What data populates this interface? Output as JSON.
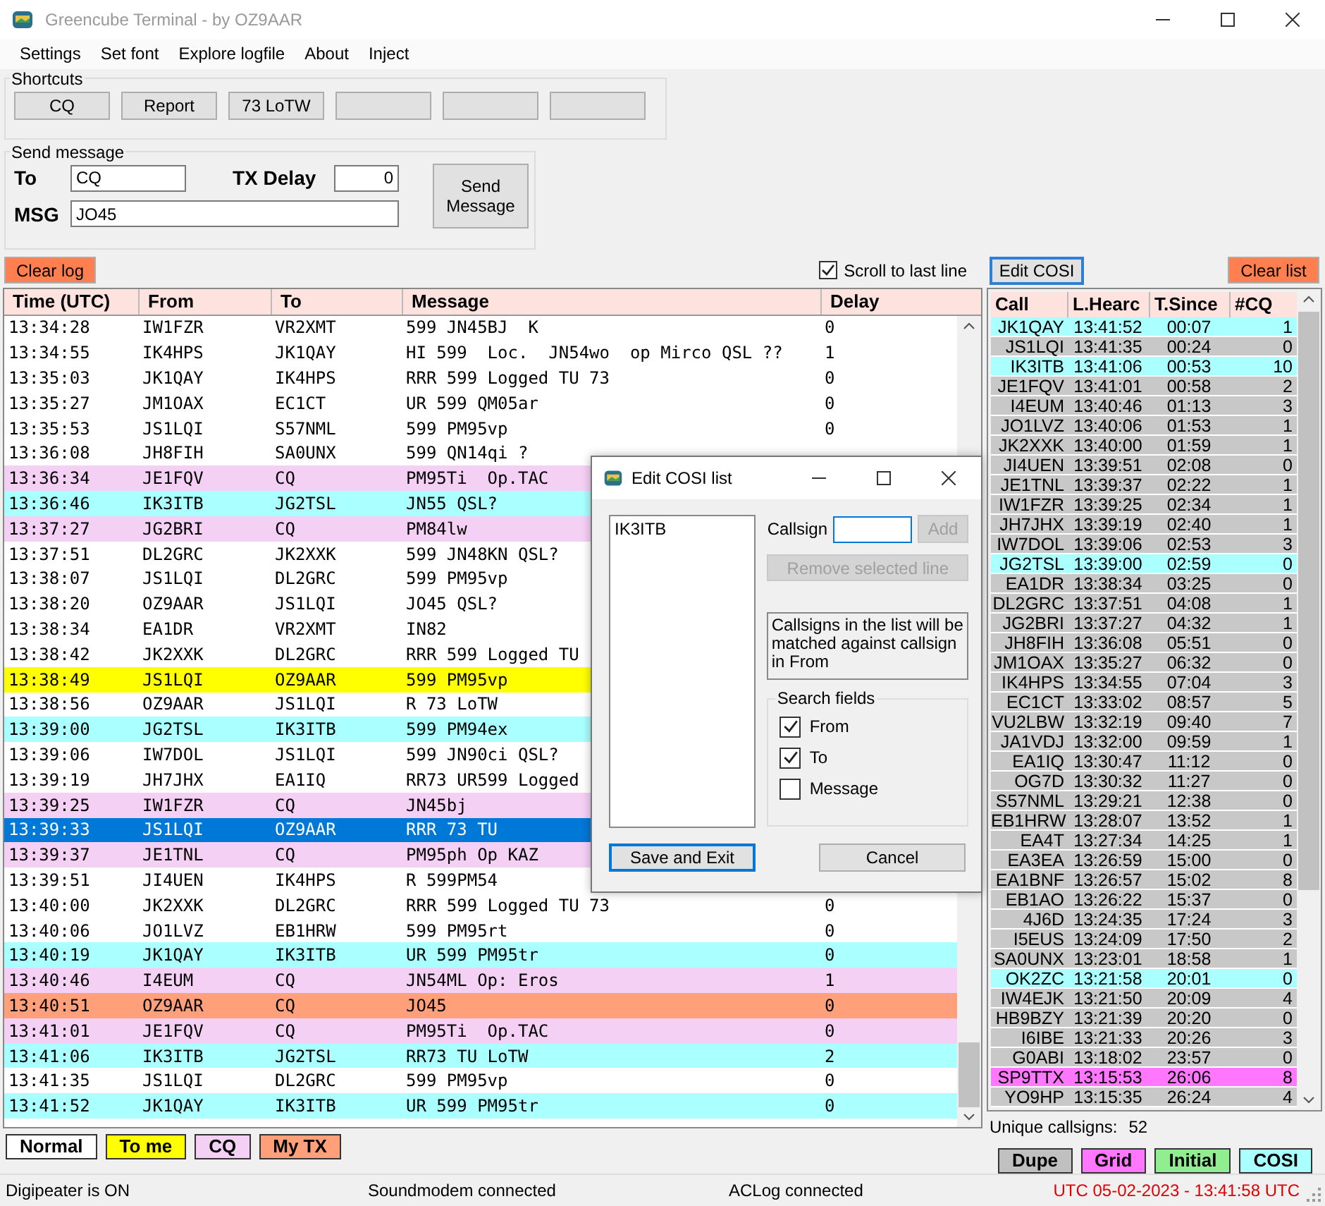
{
  "window": {
    "title": "Greencube Terminal - by OZ9AAR"
  },
  "menu": [
    "Settings",
    "Set font",
    "Explore logfile",
    "About",
    "Inject"
  ],
  "shortcuts": {
    "title": "Shortcuts",
    "buttons": [
      {
        "kind": "text",
        "label": "CQ"
      },
      {
        "kind": "text",
        "label": "Report"
      },
      {
        "kind": "text",
        "label": "73 LoTW"
      },
      {
        "kind": "blank"
      },
      {
        "kind": "blank"
      },
      {
        "kind": "blank"
      }
    ]
  },
  "send_message": {
    "title": "Send message",
    "to_label": "To",
    "to_value": "CQ",
    "tx_delay_label": "TX Delay",
    "tx_delay_value": "0",
    "msg_label": "MSG",
    "msg_value": "JO45",
    "send_button": "Send Message"
  },
  "clear_log": "Clear log",
  "scroll_to_last_line": {
    "label": "Scroll to last line",
    "checked": true
  },
  "log": {
    "columns": [
      "Time (UTC)",
      "From",
      "To",
      "Message",
      "Delay"
    ],
    "rows": [
      {
        "time": "13:34:28",
        "from": "IW1FZR",
        "to": "VR2XMT",
        "message": "599 JN45BJ  K",
        "delay": "0",
        "kind": "normal"
      },
      {
        "time": "13:34:55",
        "from": "IK4HPS",
        "to": "JK1QAY",
        "message": "HI 599  Loc.  JN54wo  op Mirco QSL ??",
        "delay": "1",
        "kind": "normal"
      },
      {
        "time": "13:35:03",
        "from": "JK1QAY",
        "to": "IK4HPS",
        "message": "RRR 599 Logged TU 73",
        "delay": "0",
        "kind": "normal"
      },
      {
        "time": "13:35:27",
        "from": "JM1OAX",
        "to": "EC1CT",
        "message": "UR 599 QM05ar",
        "delay": "0",
        "kind": "normal"
      },
      {
        "time": "13:35:53",
        "from": "JS1LQI",
        "to": "S57NML",
        "message": "599 PM95vp",
        "delay": "0",
        "kind": "normal"
      },
      {
        "time": "13:36:08",
        "from": "JH8FIH",
        "to": "SA0UNX",
        "message": "599 QN14qi ?",
        "kind": "normal"
      },
      {
        "time": "13:36:34",
        "from": "JE1FQV",
        "to": "CQ",
        "message": "PM95Ti  Op.TAC",
        "kind": "cq"
      },
      {
        "time": "13:36:46",
        "from": "IK3ITB",
        "to": "JG2TSL",
        "message": "JN55 QSL?",
        "kind": "cosi"
      },
      {
        "time": "13:37:27",
        "from": "JG2BRI",
        "to": "CQ",
        "message": "PM84lw",
        "kind": "cq"
      },
      {
        "time": "13:37:51",
        "from": "DL2GRC",
        "to": "JK2XXK",
        "message": "599 JN48KN QSL?",
        "kind": "normal"
      },
      {
        "time": "13:38:07",
        "from": "JS1LQI",
        "to": "DL2GRC",
        "message": "599 PM95vp",
        "kind": "normal"
      },
      {
        "time": "13:38:20",
        "from": "OZ9AAR",
        "to": "JS1LQI",
        "message": "JO45 QSL?",
        "kind": "normal"
      },
      {
        "time": "13:38:34",
        "from": "EA1DR",
        "to": "VR2XMT",
        "message": "IN82",
        "kind": "normal"
      },
      {
        "time": "13:38:42",
        "from": "JK2XXK",
        "to": "DL2GRC",
        "message": "RRR 599 Logged TU",
        "kind": "normal"
      },
      {
        "time": "13:38:49",
        "from": "JS1LQI",
        "to": "OZ9AAR",
        "message": "599 PM95vp",
        "kind": "to_me"
      },
      {
        "time": "13:38:56",
        "from": "OZ9AAR",
        "to": "JS1LQI",
        "message": "R 73 LoTW",
        "kind": "normal"
      },
      {
        "time": "13:39:00",
        "from": "JG2TSL",
        "to": "IK3ITB",
        "message": "599 PM94ex",
        "kind": "cosi"
      },
      {
        "time": "13:39:06",
        "from": "IW7DOL",
        "to": "JS1LQI",
        "message": "599 JN90ci QSL?",
        "kind": "normal"
      },
      {
        "time": "13:39:19",
        "from": "JH7JHX",
        "to": "EA1IQ",
        "message": "RR73 UR599 Logged",
        "kind": "normal"
      },
      {
        "time": "13:39:25",
        "from": "IW1FZR",
        "to": "CQ",
        "message": "JN45bj",
        "kind": "cq"
      },
      {
        "time": "13:39:33",
        "from": "JS1LQI",
        "to": "OZ9AAR",
        "message": "RRR 73 TU",
        "kind": "selected"
      },
      {
        "time": "13:39:37",
        "from": "JE1TNL",
        "to": "CQ",
        "message": "PM95ph Op KAZ",
        "kind": "cq"
      },
      {
        "time": "13:39:51",
        "from": "JI4UEN",
        "to": "IK4HPS",
        "message": "R 599PM54",
        "kind": "normal"
      },
      {
        "time": "13:40:00",
        "from": "JK2XXK",
        "to": "DL2GRC",
        "message": "RRR 599 Logged TU 73",
        "delay": "0",
        "kind": "normal"
      },
      {
        "time": "13:40:06",
        "from": "JO1LVZ",
        "to": "EB1HRW",
        "message": "599 PM95rt",
        "delay": "0",
        "kind": "normal"
      },
      {
        "time": "13:40:19",
        "from": "JK1QAY",
        "to": "IK3ITB",
        "message": "UR 599 PM95tr",
        "delay": "0",
        "kind": "cosi"
      },
      {
        "time": "13:40:46",
        "from": "I4EUM",
        "to": "CQ",
        "message": "JN54ML Op: Eros",
        "delay": "1",
        "kind": "cq"
      },
      {
        "time": "13:40:51",
        "from": "OZ9AAR",
        "to": "CQ",
        "message": "JO45",
        "delay": "0",
        "kind": "my_tx"
      },
      {
        "time": "13:41:01",
        "from": "JE1FQV",
        "to": "CQ",
        "message": "PM95Ti  Op.TAC",
        "delay": "0",
        "kind": "cq"
      },
      {
        "time": "13:41:06",
        "from": "IK3ITB",
        "to": "JG2TSL",
        "message": "RR73 TU LoTW",
        "delay": "2",
        "kind": "cosi"
      },
      {
        "time": "13:41:35",
        "from": "JS1LQI",
        "to": "DL2GRC",
        "message": "599 PM95vp",
        "delay": "0",
        "kind": "normal"
      },
      {
        "time": "13:41:52",
        "from": "JK1QAY",
        "to": "IK3ITB",
        "message": "UR 599 PM95tr",
        "delay": "0",
        "kind": "cosi"
      }
    ]
  },
  "log_legend": [
    {
      "label": "Normal",
      "color": "#ffffff"
    },
    {
      "label": "To me",
      "color": "#ffff00"
    },
    {
      "label": "CQ",
      "color": "#f5d0f5"
    },
    {
      "label": "My TX",
      "color": "#ffa07a"
    }
  ],
  "cosi_panel": {
    "edit_button": "Edit COSI",
    "clear_button": "Clear list",
    "columns": [
      "Call",
      "L.Hearc",
      "T.Since",
      "#CQ"
    ],
    "rows": [
      {
        "call": "JK1QAY",
        "heard": "13:41:52",
        "since": "00:07",
        "cq": "1",
        "kind": "cosi"
      },
      {
        "call": "JS1LQI",
        "heard": "13:41:35",
        "since": "00:24",
        "cq": "0",
        "kind": "dupe"
      },
      {
        "call": "IK3ITB",
        "heard": "13:41:06",
        "since": "00:53",
        "cq": "10",
        "kind": "cosi"
      },
      {
        "call": "JE1FQV",
        "heard": "13:41:01",
        "since": "00:58",
        "cq": "2",
        "kind": "dupe"
      },
      {
        "call": "I4EUM",
        "heard": "13:40:46",
        "since": "01:13",
        "cq": "3",
        "kind": "dupe"
      },
      {
        "call": "JO1LVZ",
        "heard": "13:40:06",
        "since": "01:53",
        "cq": "1",
        "kind": "dupe"
      },
      {
        "call": "JK2XXK",
        "heard": "13:40:00",
        "since": "01:59",
        "cq": "1",
        "kind": "dupe"
      },
      {
        "call": "JI4UEN",
        "heard": "13:39:51",
        "since": "02:08",
        "cq": "0",
        "kind": "dupe"
      },
      {
        "call": "JE1TNL",
        "heard": "13:39:37",
        "since": "02:22",
        "cq": "1",
        "kind": "dupe"
      },
      {
        "call": "IW1FZR",
        "heard": "13:39:25",
        "since": "02:34",
        "cq": "1",
        "kind": "dupe"
      },
      {
        "call": "JH7JHX",
        "heard": "13:39:19",
        "since": "02:40",
        "cq": "1",
        "kind": "dupe"
      },
      {
        "call": "IW7DOL",
        "heard": "13:39:06",
        "since": "02:53",
        "cq": "3",
        "kind": "dupe"
      },
      {
        "call": "JG2TSL",
        "heard": "13:39:00",
        "since": "02:59",
        "cq": "0",
        "kind": "cosi"
      },
      {
        "call": "EA1DR",
        "heard": "13:38:34",
        "since": "03:25",
        "cq": "0",
        "kind": "dupe"
      },
      {
        "call": "DL2GRC",
        "heard": "13:37:51",
        "since": "04:08",
        "cq": "1",
        "kind": "dupe"
      },
      {
        "call": "JG2BRI",
        "heard": "13:37:27",
        "since": "04:32",
        "cq": "1",
        "kind": "dupe"
      },
      {
        "call": "JH8FIH",
        "heard": "13:36:08",
        "since": "05:51",
        "cq": "0",
        "kind": "dupe"
      },
      {
        "call": "JM1OAX",
        "heard": "13:35:27",
        "since": "06:32",
        "cq": "0",
        "kind": "dupe"
      },
      {
        "call": "IK4HPS",
        "heard": "13:34:55",
        "since": "07:04",
        "cq": "3",
        "kind": "dupe"
      },
      {
        "call": "EC1CT",
        "heard": "13:33:02",
        "since": "08:57",
        "cq": "5",
        "kind": "dupe"
      },
      {
        "call": "VU2LBW",
        "heard": "13:32:19",
        "since": "09:40",
        "cq": "7",
        "kind": "dupe"
      },
      {
        "call": "JA1VDJ",
        "heard": "13:32:00",
        "since": "09:59",
        "cq": "1",
        "kind": "dupe"
      },
      {
        "call": "EA1IQ",
        "heard": "13:30:47",
        "since": "11:12",
        "cq": "0",
        "kind": "dupe"
      },
      {
        "call": "OG7D",
        "heard": "13:30:32",
        "since": "11:27",
        "cq": "0",
        "kind": "dupe"
      },
      {
        "call": "S57NML",
        "heard": "13:29:21",
        "since": "12:38",
        "cq": "0",
        "kind": "dupe"
      },
      {
        "call": "EB1HRW",
        "heard": "13:28:07",
        "since": "13:52",
        "cq": "1",
        "kind": "dupe"
      },
      {
        "call": "EA4T",
        "heard": "13:27:34",
        "since": "14:25",
        "cq": "1",
        "kind": "dupe"
      },
      {
        "call": "EA3EA",
        "heard": "13:26:59",
        "since": "15:00",
        "cq": "0",
        "kind": "dupe"
      },
      {
        "call": "EA1BNF",
        "heard": "13:26:57",
        "since": "15:02",
        "cq": "8",
        "kind": "dupe"
      },
      {
        "call": "EB1AO",
        "heard": "13:26:22",
        "since": "15:37",
        "cq": "0",
        "kind": "dupe"
      },
      {
        "call": "4J6D",
        "heard": "13:24:35",
        "since": "17:24",
        "cq": "3",
        "kind": "dupe"
      },
      {
        "call": "I5EUS",
        "heard": "13:24:09",
        "since": "17:50",
        "cq": "2",
        "kind": "dupe"
      },
      {
        "call": "SA0UNX",
        "heard": "13:23:01",
        "since": "18:58",
        "cq": "1",
        "kind": "dupe"
      },
      {
        "call": "OK2ZC",
        "heard": "13:21:58",
        "since": "20:01",
        "cq": "0",
        "kind": "cosi"
      },
      {
        "call": "IW4EJK",
        "heard": "13:21:50",
        "since": "20:09",
        "cq": "4",
        "kind": "dupe"
      },
      {
        "call": "HB9BZY",
        "heard": "13:21:39",
        "since": "20:20",
        "cq": "0",
        "kind": "dupe"
      },
      {
        "call": "I6IBE",
        "heard": "13:21:33",
        "since": "20:26",
        "cq": "3",
        "kind": "dupe"
      },
      {
        "call": "G0ABI",
        "heard": "13:18:02",
        "since": "23:57",
        "cq": "0",
        "kind": "dupe"
      },
      {
        "call": "SP9TTX",
        "heard": "13:15:53",
        "since": "26:06",
        "cq": "8",
        "kind": "grid"
      },
      {
        "call": "YO9HP",
        "heard": "13:15:35",
        "since": "26:24",
        "cq": "4",
        "kind": "dupe"
      }
    ],
    "unique_label": "Unique callsigns:",
    "unique_count": "52",
    "legend": [
      {
        "label": "Dupe",
        "color": "#c0c0c0"
      },
      {
        "label": "Grid",
        "color": "#ff77ff"
      },
      {
        "label": "Initial",
        "color": "#90ee90"
      },
      {
        "label": "COSI",
        "color": "#aaffff"
      }
    ]
  },
  "status_bar": {
    "digipeater": "Digipeater is ON",
    "soundmodem": "Soundmodem connected",
    "aclog": "ACLog connected",
    "clock": "UTC 05-02-2023 - 13:41:58 UTC"
  },
  "dialog": {
    "title": "Edit COSI list",
    "list_items": [
      "IK3ITB"
    ],
    "callsign_label": "Callsign",
    "add_button": {
      "label": "Add",
      "disabled": true
    },
    "remove_button": {
      "label": "Remove selected line",
      "disabled": true
    },
    "info": "Callsigns in the list will be matched against callsign in From",
    "search_title": "Search fields",
    "search_fields": [
      {
        "label": "From",
        "checked": true
      },
      {
        "label": "To",
        "checked": true
      },
      {
        "label": "Message",
        "checked": false
      }
    ],
    "save_button": "Save and Exit",
    "cancel_button": "Cancel"
  }
}
